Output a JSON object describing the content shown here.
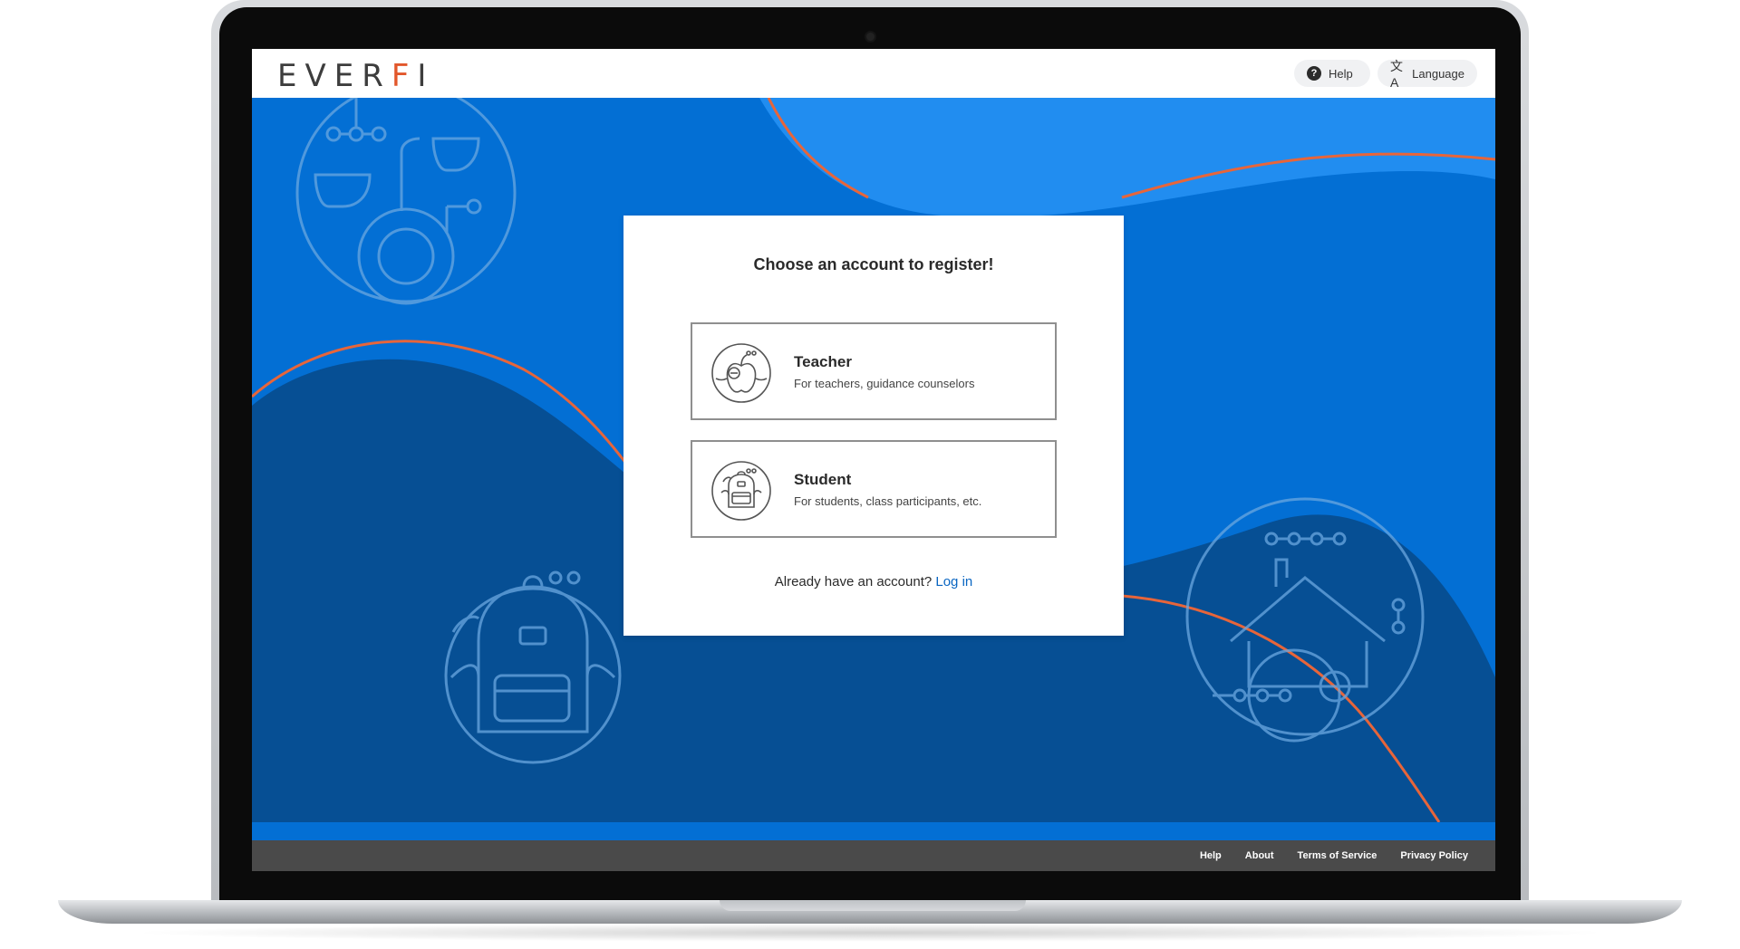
{
  "header": {
    "logo_pre": "EVER",
    "logo_f": "F",
    "logo_post": "I",
    "help_label": "Help",
    "language_label": "Language"
  },
  "card": {
    "title": "Choose an account to register!",
    "options": [
      {
        "title": "Teacher",
        "description": "For teachers, guidance counselors",
        "icon": "apple-icon"
      },
      {
        "title": "Student",
        "description": "For students, class participants, etc.",
        "icon": "backpack-icon"
      }
    ],
    "account_prompt": "Already have an account?",
    "login_label": "Log in"
  },
  "footer": {
    "links": [
      "Help",
      "About",
      "Terms of Service",
      "Privacy Policy"
    ]
  },
  "colors": {
    "brand_blue": "#036fd4",
    "dark_blue": "#064f94",
    "light_blue": "#218df0",
    "accent_orange": "#e2572b",
    "footer_gray": "#4a4a4a"
  }
}
